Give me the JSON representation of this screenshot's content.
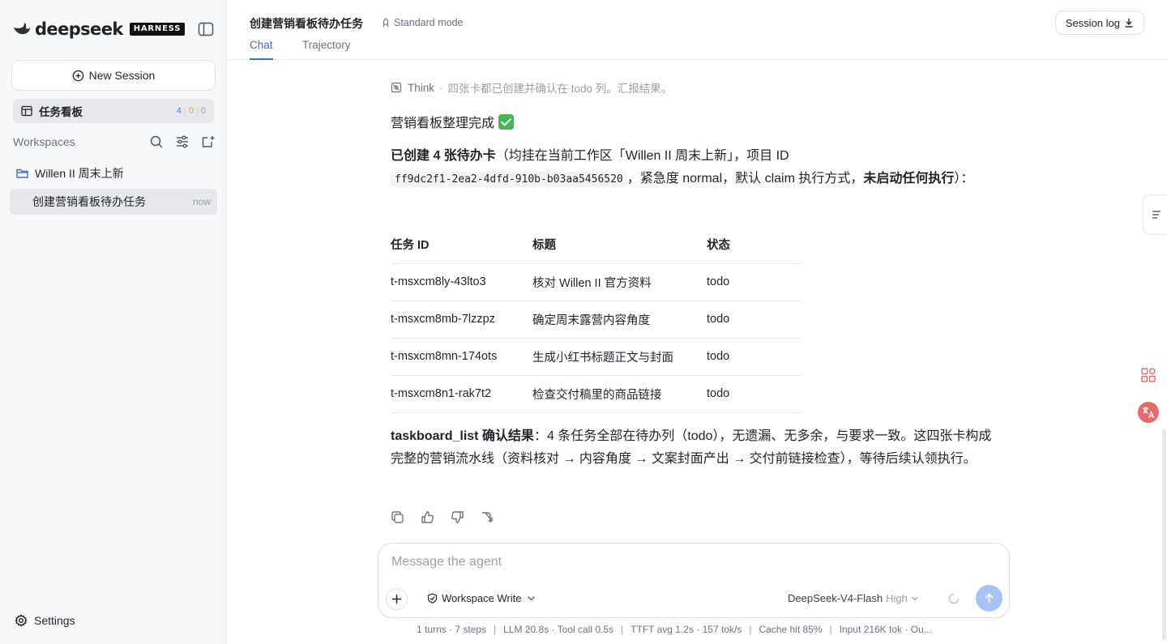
{
  "brand": {
    "name": "deepseek",
    "badge": "HARNESS"
  },
  "sidebar": {
    "new_session_label": "New Session",
    "board": {
      "label": "任务看板",
      "count_todo": "4",
      "count_doing": "0",
      "count_done": "0"
    },
    "workspaces_title": "Workspaces",
    "workspace": {
      "name": "Willen II 周末上新"
    },
    "session": {
      "label": "创建营销看板待办任务",
      "time": "now"
    },
    "settings_label": "Settings"
  },
  "header": {
    "title": "创建营销看板待办任务",
    "mode": "Standard mode",
    "tabs": [
      {
        "label": "Chat"
      },
      {
        "label": "Trajectory"
      }
    ],
    "session_log_label": "Session log"
  },
  "message": {
    "think_label": "Think",
    "think_text": "四张卡都已创建并确认在 todo 列。汇报结果。",
    "title": "营销看板整理完成",
    "created_bold": "已创建 4 张待办卡",
    "created_text": "（均挂在当前工作区「Willen II 周末上新」，项目 ID",
    "project_id": "ff9dc2f1-2ea2-4dfd-910b-b03aa5456520",
    "created_text2": "，紧急度 normal，默认 claim 执行方式，",
    "not_started_bold": "未启动任何执行",
    "created_end": "）：",
    "table": {
      "headers": [
        "任务 ID",
        "标题",
        "状态"
      ],
      "rows": [
        [
          "t-msxcm8ly-43lto3",
          "核对 Willen II 官方资料",
          "todo"
        ],
        [
          "t-msxcm8mb-7lzzpz",
          "确定周末露营内容角度",
          "todo"
        ],
        [
          "t-msxcm8mn-174ots",
          "生成小红书标题正文与封面",
          "todo"
        ],
        [
          "t-msxcm8n1-rak7t2",
          "检查交付稿里的商品链接",
          "todo"
        ]
      ]
    },
    "confirm_bold": "taskboard_list 确认结果",
    "confirm_text": "：4 条任务全部在待办列（todo），无遗漏、无多余，与要求一致。这四张卡构成完整的营销流水线（资料核对 → 内容角度 → 文案封面产出 → 交付前链接检查），等待后续认领执行。"
  },
  "composer": {
    "placeholder": "Message the agent",
    "permission": "Workspace Write",
    "model": "DeepSeek-V4-Flash",
    "effort": "High"
  },
  "stats": {
    "turns": "1 turns · 7 steps",
    "llm": "LLM 20.8s · Tool call 0.5s",
    "ttft": "TTFT avg 1.2s · 157 tok/s",
    "cache": "Cache hit 85%",
    "input": "Input 216K tok · Ou..."
  },
  "colors": {
    "accent": "#3b6fd8",
    "send_button": "#a8c3f5",
    "todo_count": "#3b82f6",
    "doing_count": "#f59e0b",
    "check_emoji": "#3fb950"
  },
  "icons": [
    "whale-logo-icon",
    "sidebar-toggle-icon",
    "plus-circle-icon",
    "board-icon",
    "search-icon",
    "filter-icon",
    "new-folder-icon",
    "folder-icon",
    "gear-icon",
    "mode-icon",
    "download-icon",
    "think-icon",
    "check-mark-icon",
    "copy-icon",
    "thumbs-up-icon",
    "thumbs-down-icon",
    "branch-icon",
    "plus-icon",
    "shield-icon",
    "chevron-down-icon",
    "spinner-icon",
    "arrow-up-icon",
    "outline-icon",
    "apps-icon",
    "translate-icon"
  ]
}
